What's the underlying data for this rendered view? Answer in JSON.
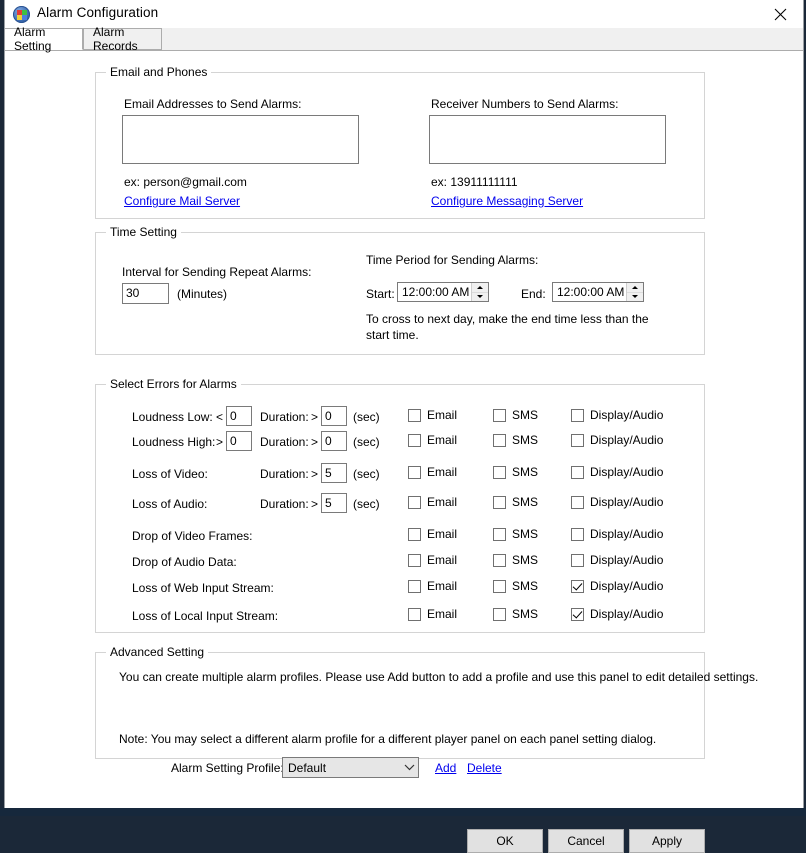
{
  "window": {
    "title": "Alarm Configuration",
    "icon": "app-grid-icon",
    "close_icon": "close-icon"
  },
  "tabs": [
    {
      "label": "Alarm Setting",
      "active": true
    },
    {
      "label": "Alarm Records",
      "active": false
    }
  ],
  "email_and_phones": {
    "legend": "Email and Phones",
    "email_label": "Email Addresses to Send Alarms:",
    "email_value": "",
    "email_example": "ex: person@gmail.com",
    "email_link": "Configure Mail Server",
    "receiver_label": "Receiver Numbers to Send Alarms:",
    "receiver_value": "",
    "receiver_example": "ex: 13911111111",
    "receiver_link": "Configure Messaging Server"
  },
  "time_setting": {
    "legend": "Time Setting",
    "interval_label": "Interval for Sending Repeat Alarms:",
    "interval_value": "30",
    "interval_units": "(Minutes)",
    "period_label": "Time Period for Sending Alarms:",
    "start_label": "Start:",
    "start_value": "12:00:00 AM",
    "end_label": "End:",
    "end_value": "12:00:00 AM",
    "hint_line1": "To cross to next day, make the end time less than the",
    "hint_line2": "start time."
  },
  "select_errors": {
    "legend": "Select Errors for Alarms",
    "duration_label": "Duration:",
    "gt": ">",
    "lt": "<",
    "sec": "(sec)",
    "col_email": "Email",
    "col_sms": "SMS",
    "col_display": "Display/Audio",
    "rows": [
      {
        "label": "Loudness Low:",
        "cmp": "<",
        "threshold": "0",
        "has_threshold": true,
        "has_duration": true,
        "duration": "0",
        "email": false,
        "sms": false,
        "display": false
      },
      {
        "label": "Loudness High:",
        "cmp": ">",
        "threshold": "0",
        "has_threshold": true,
        "has_duration": true,
        "duration": "0",
        "email": false,
        "sms": false,
        "display": false
      },
      {
        "label": "Loss of Video:",
        "cmp": "",
        "threshold": "",
        "has_threshold": false,
        "has_duration": true,
        "duration": "5",
        "email": false,
        "sms": false,
        "display": false
      },
      {
        "label": "Loss of Audio:",
        "cmp": "",
        "threshold": "",
        "has_threshold": false,
        "has_duration": true,
        "duration": "5",
        "email": false,
        "sms": false,
        "display": false
      },
      {
        "label": "Drop of Video Frames:",
        "cmp": "",
        "threshold": "",
        "has_threshold": false,
        "has_duration": false,
        "duration": "",
        "email": false,
        "sms": false,
        "display": false
      },
      {
        "label": "Drop of Audio Data:",
        "cmp": "",
        "threshold": "",
        "has_threshold": false,
        "has_duration": false,
        "duration": "",
        "email": false,
        "sms": false,
        "display": false
      },
      {
        "label": "Loss of Web Input Stream:",
        "cmp": "",
        "threshold": "",
        "has_threshold": false,
        "has_duration": false,
        "duration": "",
        "email": false,
        "sms": false,
        "display": true
      },
      {
        "label": "Loss of Local Input Stream:",
        "cmp": "",
        "threshold": "",
        "has_threshold": false,
        "has_duration": false,
        "duration": "",
        "email": false,
        "sms": false,
        "display": true
      }
    ]
  },
  "advanced_setting": {
    "legend": "Advanced Setting",
    "description": "You can create multiple alarm profiles. Please use Add button to add a profile and use this panel to edit detailed settings.",
    "profile_label": "Alarm Setting Profile:",
    "profile_value": "Default",
    "profile_options": [
      "Default"
    ],
    "add_link": "Add",
    "delete_link": "Delete",
    "note": "Note: You may select a different alarm profile for a different player panel on each panel setting dialog."
  },
  "footer": {
    "ok": "OK",
    "cancel": "Cancel",
    "apply": "Apply"
  },
  "colors": {
    "link": "#0000ee",
    "window_bg": "#ffffff",
    "group_border": "#d4d4d4",
    "button_face": "#e1e1e1"
  }
}
